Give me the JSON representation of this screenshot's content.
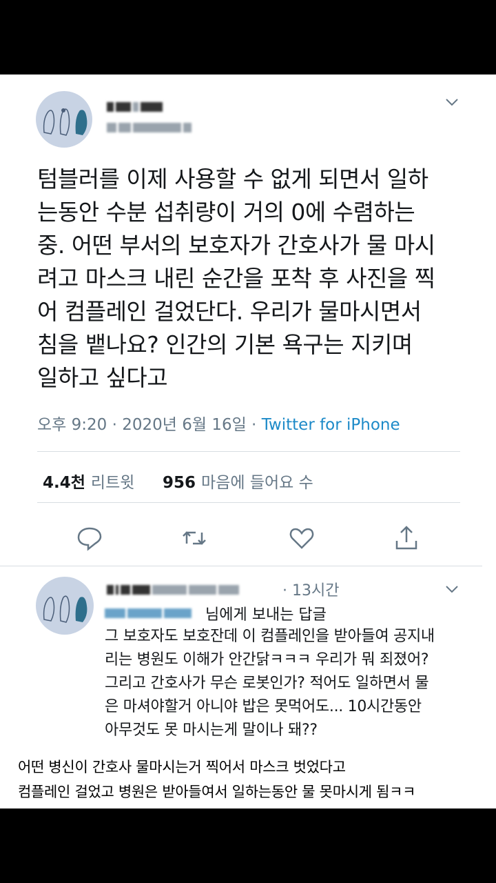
{
  "tweet": {
    "text": "텀블러를 이제 사용할 수 없게 되면서 일하\n는동안 수분 섭취량이 거의 0에 수렴하는\n중. 어떤 부서의 보호자가 간호사가 물 마시\n려고 마스크 내린 순간을 포착 후 사진을 찍\n어 컴플레인 걸었단다. 우리가 물마시면서\n침을 뱉나요? 인간의 기본 욕구는 지키며\n일하고 싶다고",
    "time": "오후 9:20 · 2020년 6월 16일 · ",
    "source": "Twitter for iPhone",
    "retweet_count": "4.4천",
    "retweet_label": "리트윗",
    "like_count": "956",
    "like_label": "마음에 들어요 수"
  },
  "reply": {
    "time": "· 13시간",
    "replying_to_suffix": "님에게 보내는 답글",
    "text": "그 보호자도 보호잔데 이 컴플레인을 받아들여 공지내\n리는 병원도 이해가 안간닭ㅋㅋㅋ 우리가 뭐 죄졌어?\n그리고 간호사가 무슨 로봇인가? 적어도 일하면서 물\n은 마셔야할거 아니야 밥은 못먹어도... 10시간동안\n아무것도 못 마시는게 말이나 돼??"
  },
  "caption": {
    "line1": "어떤 병신이 간호사 물마시는거 찍어서 마스크 벗었다고",
    "line2": "컴플레인 걸었고 병원은 받아들여서 일하는동안 물 못마시게 됨ㅋㅋ"
  },
  "icons": [
    "chevron-down-icon",
    "reply-icon",
    "retweet-icon",
    "like-icon",
    "share-icon"
  ],
  "colors": {
    "link": "#1d8ac8",
    "muted": "#657786",
    "text": "#14171a"
  }
}
